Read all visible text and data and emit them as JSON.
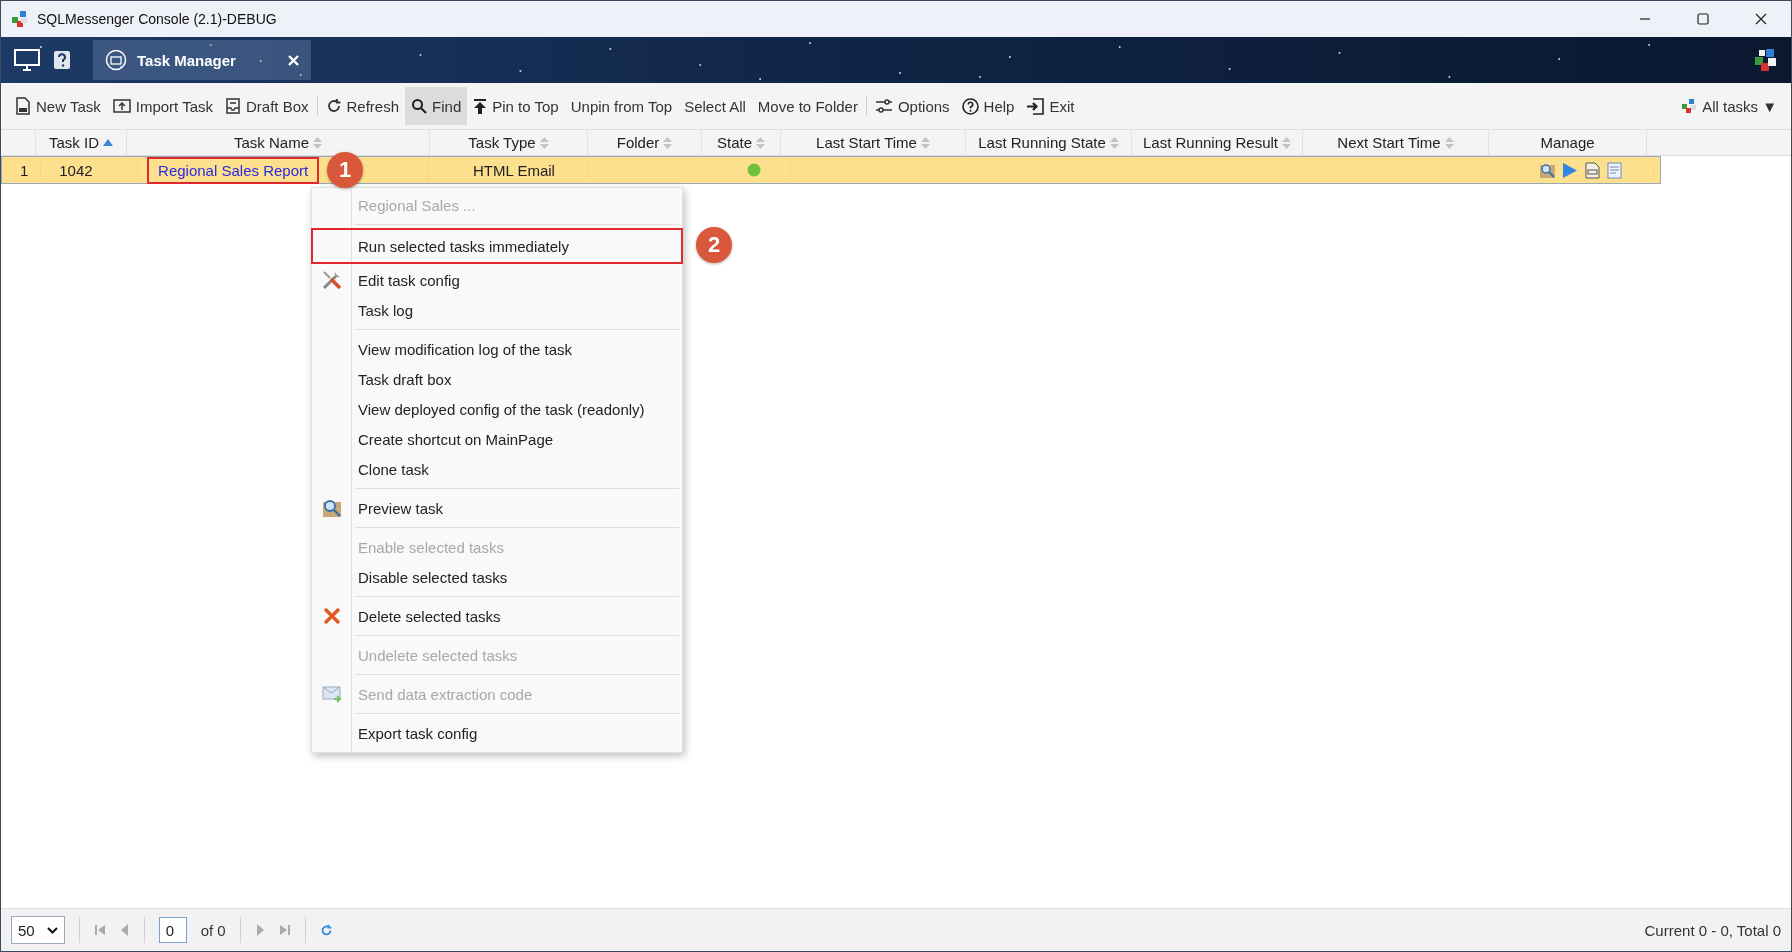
{
  "window": {
    "title": "SQLMessenger Console (2.1)-DEBUG"
  },
  "tabs": [
    {
      "label": "Task Manager",
      "selected": true
    }
  ],
  "toolbar": {
    "groups": [
      [
        {
          "label": "New Task",
          "kind": "new",
          "selected": false
        },
        {
          "label": "Import Task",
          "kind": "import",
          "selected": false
        },
        {
          "label": "Draft Box",
          "kind": "draft",
          "selected": false
        }
      ],
      [
        {
          "label": "Refresh",
          "kind": "refresh",
          "selected": false
        },
        {
          "label": "Find",
          "kind": "find",
          "selected": true
        },
        {
          "label": "Pin to Top",
          "kind": "pin",
          "selected": false
        },
        {
          "label": "Unpin from Top",
          "kind": "plain",
          "selected": false
        },
        {
          "label": "Select All",
          "kind": "plain",
          "selected": false
        },
        {
          "label": "Move to Folder",
          "kind": "plain",
          "selected": false
        }
      ],
      [
        {
          "label": "Options",
          "kind": "options",
          "selected": false
        },
        {
          "label": "Help",
          "kind": "help",
          "selected": false
        },
        {
          "label": "Exit",
          "kind": "exit",
          "selected": false
        }
      ]
    ],
    "filter": {
      "label": "All tasks",
      "caret": "▼"
    }
  },
  "table": {
    "columns": [
      {
        "label": "Task ID",
        "sortable": true,
        "sorted": true
      },
      {
        "label": "Task Name",
        "sortable": true,
        "sorted": false
      },
      {
        "label": "Task Type",
        "sortable": true,
        "sorted": false
      },
      {
        "label": "Folder",
        "sortable": true,
        "sorted": false
      },
      {
        "label": "State",
        "sortable": true,
        "sorted": false
      },
      {
        "label": "Last Start Time",
        "sortable": true,
        "sorted": false
      },
      {
        "label": "Last Running State",
        "sortable": true,
        "sorted": false
      },
      {
        "label": "Last Running Result",
        "sortable": true,
        "sorted": false
      },
      {
        "label": "Next Start Time",
        "sortable": true,
        "sorted": false
      },
      {
        "label": "Manage",
        "sortable": false
      }
    ],
    "rows": [
      {
        "number": "1",
        "task_id": "1042",
        "task_name": "Regional Sales Report",
        "name_callout": "1",
        "task_type": "HTML Email",
        "state": {
          "color": "#6cc33a"
        },
        "selected": true
      }
    ]
  },
  "context_menu": {
    "groups": [
      [
        {
          "label": "Regional Sales ...",
          "kind": "plain",
          "disabled": true
        }
      ],
      [
        {
          "label": "Run selected tasks immediately",
          "kind": "plain",
          "disabled": false,
          "callout": "2"
        },
        {
          "label": "Edit task config",
          "kind": "edit",
          "disabled": false
        },
        {
          "label": "Task log",
          "kind": "plain",
          "disabled": false
        }
      ],
      [
        {
          "label": "View modification log of the task",
          "kind": "plain",
          "disabled": false
        },
        {
          "label": "Task draft box",
          "kind": "plain",
          "disabled": false
        },
        {
          "label": "View deployed config of the task (readonly)",
          "kind": "plain",
          "disabled": false
        },
        {
          "label": "Create shortcut on MainPage",
          "kind": "plain",
          "disabled": false
        },
        {
          "label": "Clone task",
          "kind": "plain",
          "disabled": false
        }
      ],
      [
        {
          "label": "Preview task",
          "kind": "preview",
          "disabled": false
        }
      ],
      [
        {
          "label": "Enable selected tasks",
          "kind": "plain",
          "disabled": true
        },
        {
          "label": "Disable selected tasks",
          "kind": "plain",
          "disabled": false
        }
      ],
      [
        {
          "label": "Delete selected tasks",
          "kind": "delete",
          "disabled": false
        }
      ],
      [
        {
          "label": "Undelete selected tasks",
          "kind": "plain",
          "disabled": true
        }
      ],
      [
        {
          "label": "Send data extraction code",
          "kind": "send",
          "disabled": true
        }
      ],
      [
        {
          "label": "Export task config",
          "kind": "plain",
          "disabled": false
        }
      ]
    ]
  },
  "pager": {
    "page_size": "50",
    "page": "0",
    "of": "of 0",
    "summary": "Current 0 - 0, Total 0"
  }
}
